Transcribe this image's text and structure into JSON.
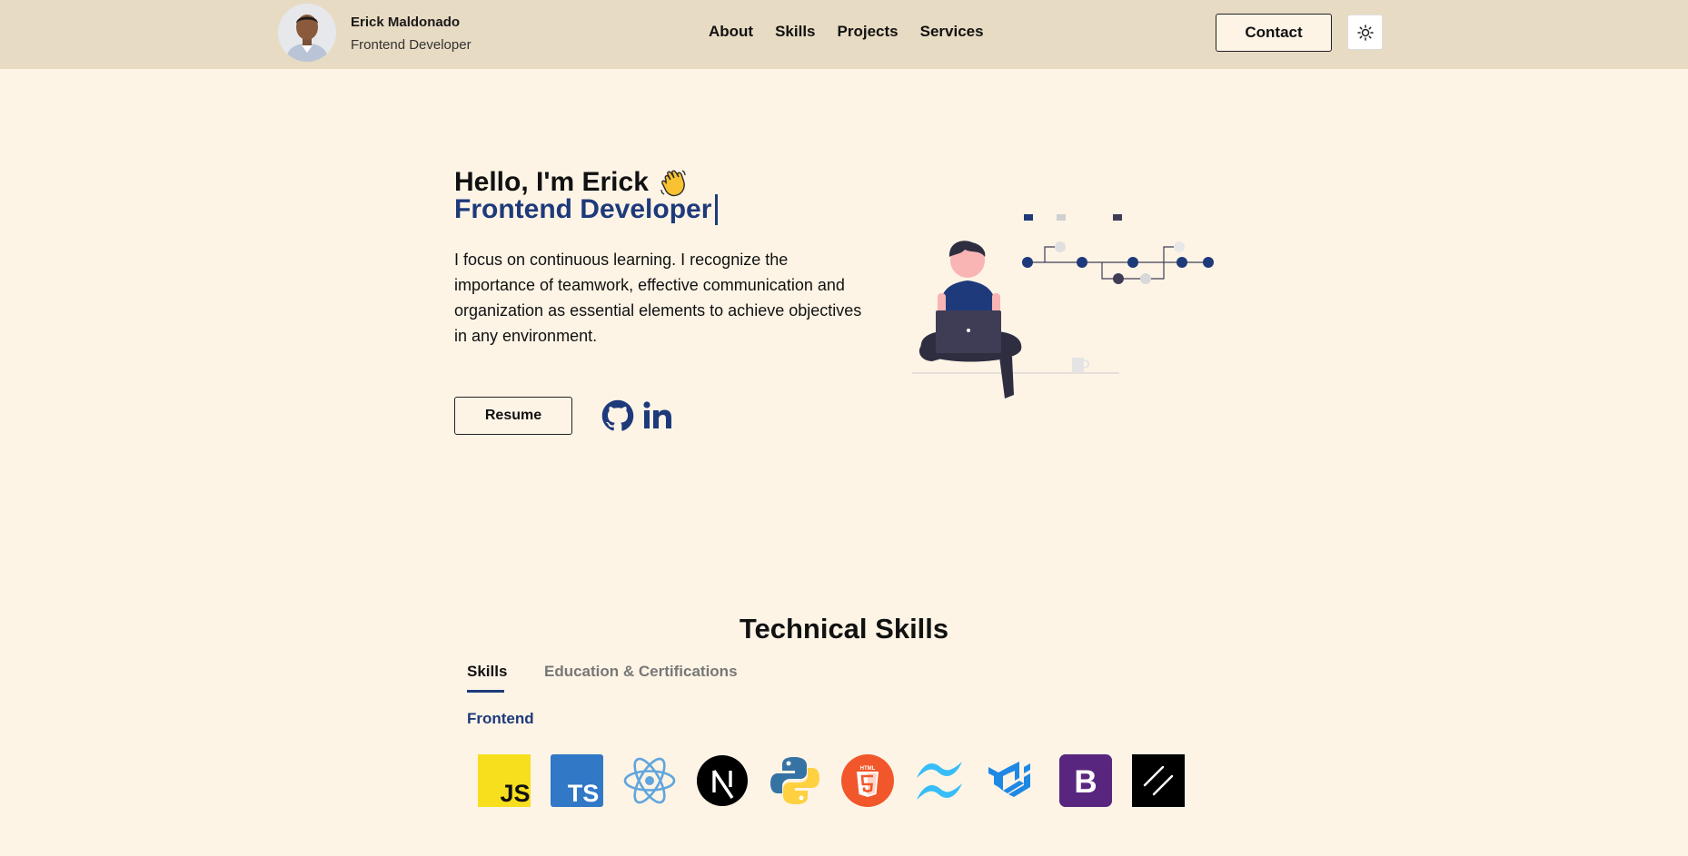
{
  "header": {
    "name": "Erick Maldonado",
    "role": "Frontend Developer",
    "nav": [
      "About",
      "Skills",
      "Projects",
      "Services"
    ],
    "contact_label": "Contact",
    "theme_icon": "sun-icon"
  },
  "hero": {
    "greeting": "Hello, I'm Erick",
    "greeting_emoji": "waving-hand-icon",
    "typed_role": "Frontend Developer",
    "description": "I focus on continuous learning. I recognize the importance of teamwork, effective communication and organization as essential elements to achieve objectives in any environment.",
    "resume_label": "Resume",
    "social": [
      "github-icon",
      "linkedin-icon"
    ],
    "illustration": "person-with-laptop-illustration"
  },
  "skills": {
    "title": "Technical Skills",
    "tabs": [
      "Skills",
      "Education & Certifications"
    ],
    "active_tab": "Skills",
    "category": "Frontend",
    "icons": [
      "javascript-icon",
      "typescript-icon",
      "react-icon",
      "nextjs-icon",
      "python-icon",
      "html5-icon",
      "tailwind-icon",
      "material-ui-icon",
      "bootstrap-icon",
      "shadcn-icon"
    ],
    "icon_text": {
      "js": "JS",
      "ts": "TS",
      "bootstrap": "B"
    }
  },
  "colors": {
    "background": "#fdf4e6",
    "header": "#e8dbc3",
    "accent": "#1e3a7b"
  }
}
